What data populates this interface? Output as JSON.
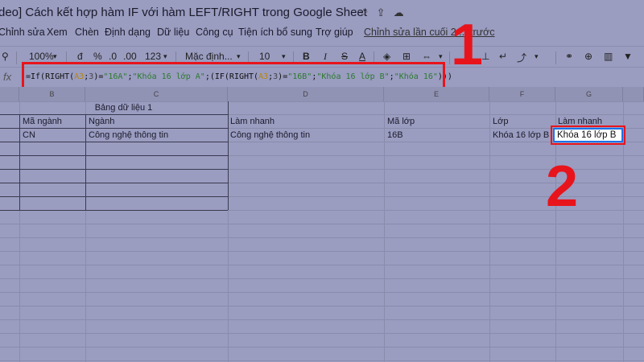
{
  "title": "deo] Cách kết hợp hàm IF với hàm LEFT/RIGHT trong Google Sheet",
  "title_icons": [
    "star-icon",
    "move-to-folder-icon",
    "cloud-status-icon"
  ],
  "menu": {
    "items": [
      "Chỉnh sửa",
      "Xem",
      "Chèn",
      "Định dạng",
      "Dữ liệu",
      "Công cụ",
      "Tiện ích bổ sung",
      "Trợ giúp"
    ],
    "last_edit": "Chỉnh sửa lần cuối 2 ... trước"
  },
  "toolbar": {
    "zoom": "100%",
    "currency": "đ",
    "percent": "%",
    "dec_less": ".0",
    "dec_more": ".00",
    "more_formats": "123",
    "font": "Mặc định...",
    "font_size": "10",
    "bold": "B",
    "italic": "I",
    "strike": "S",
    "text_color": "A"
  },
  "formula": {
    "parts": [
      "=If(RIGHT(",
      "A3",
      ";",
      "3",
      ")=",
      "\"16A\"",
      ";",
      "\"Khóa 16 lớp A\"",
      ";(IF(RIGHT(",
      "A3",
      ";",
      "3",
      ")=",
      "\"16B\"",
      ";",
      "\"Khóa 16 lớp B\"",
      ";",
      "\"Khóa 16\"",
      ")))"
    ]
  },
  "columns": [
    "B",
    "C",
    "D",
    "E",
    "F",
    "G"
  ],
  "sheet": {
    "merged_header": "Bảng dữ liệu 1",
    "headers": {
      "B": "Mã ngành",
      "C": "Ngành",
      "D": "Làm nhanh",
      "E": "Mã lớp",
      "F": "Lớp",
      "G": "Làm nhanh"
    },
    "row1": {
      "B": "CN",
      "C": "Công nghệ thông tin",
      "D": "Công nghệ thông tin",
      "E": "16B",
      "F": "Khóa 16 lớp B",
      "G": "Khóa 16 lớp B"
    }
  },
  "annotations": {
    "step1": "1",
    "step2": "2"
  },
  "colors": {
    "highlight_red": "#e8141b",
    "selection_blue": "#1a73e8",
    "formula_ref": "#b8860b",
    "formula_string": "#2d7a2d"
  }
}
